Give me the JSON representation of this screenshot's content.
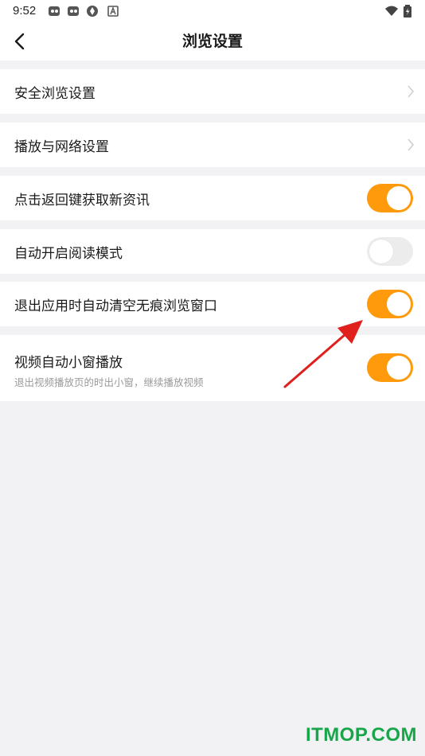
{
  "status_bar": {
    "time": "9:52",
    "icons": [
      "app-notification-icon",
      "app-notification-icon",
      "sync-icon",
      "a-badge-icon",
      "wifi-icon",
      "battery-icon"
    ]
  },
  "header": {
    "title": "浏览设置"
  },
  "settings": [
    {
      "label": "安全浏览设置",
      "control": "chevron"
    },
    {
      "label": "播放与网络设置",
      "control": "chevron"
    },
    {
      "label": "点击返回键获取新资讯",
      "control": "toggle",
      "on": true
    },
    {
      "label": "自动开启阅读模式",
      "control": "toggle",
      "on": false
    },
    {
      "label": "退出应用时自动清空无痕浏览窗口",
      "control": "toggle",
      "on": true
    },
    {
      "label": "视频自动小窗播放",
      "sublabel": "退出视频播放页的时出小窗，继续播放视频",
      "control": "toggle",
      "on": true
    }
  ],
  "colors": {
    "accent": "#ff9a0c",
    "toggle_off": "#ececec",
    "background": "#f2f2f4",
    "annotation": "#e0201c"
  },
  "watermark": "ITMOP.COM"
}
